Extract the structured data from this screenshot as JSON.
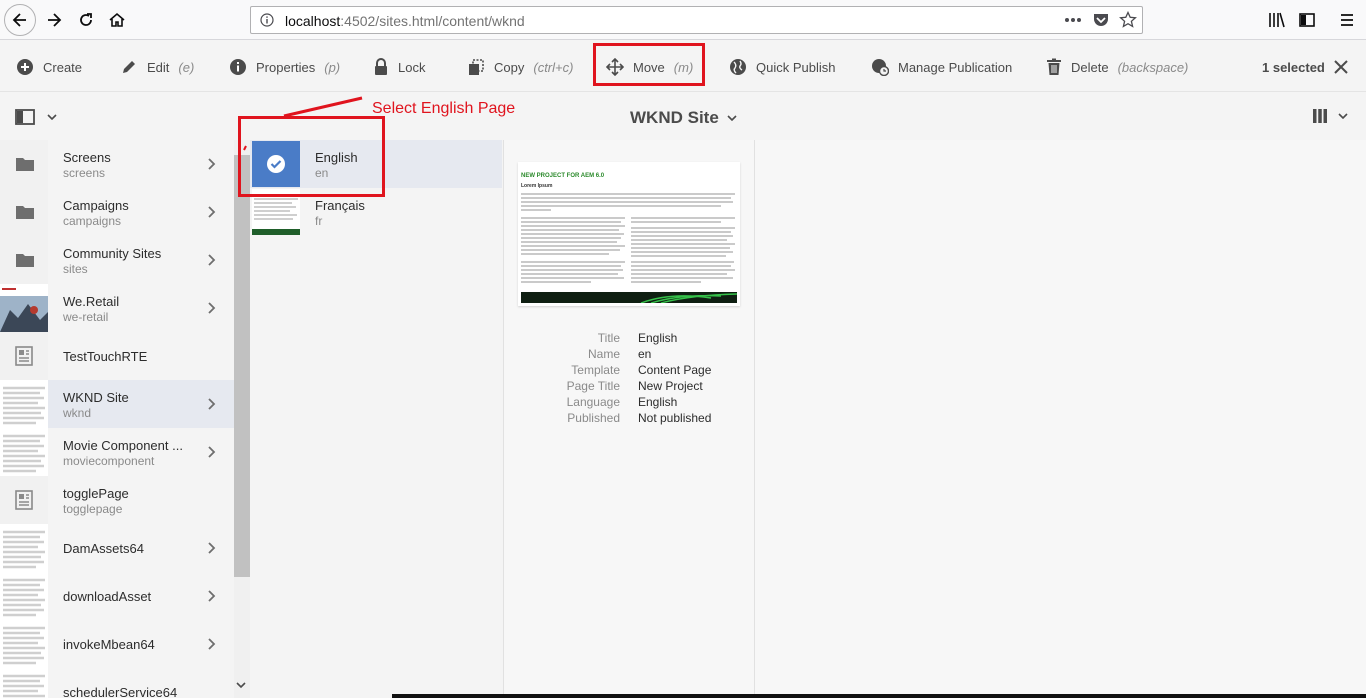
{
  "browser": {
    "url_host": "localhost",
    "url_rest": ":4502/sites.html/content/wknd"
  },
  "actions": {
    "create": "Create",
    "edit": "Edit",
    "edit_sc": "(e)",
    "properties": "Properties",
    "properties_sc": "(p)",
    "lock": "Lock",
    "copy": "Copy",
    "copy_sc": "(ctrl+c)",
    "move": "Move",
    "move_sc": "(m)",
    "quick_publish": "Quick Publish",
    "manage_publication": "Manage Publication",
    "delete": "Delete",
    "delete_sc": "(backspace)",
    "selected": "1 selected"
  },
  "header": {
    "site_title": "WKND Site"
  },
  "annotation": {
    "text": "Select English Page",
    "color": "#e0141e"
  },
  "column1": [
    {
      "name": "Screens",
      "sub": "screens",
      "thumb": "folder"
    },
    {
      "name": "Campaigns",
      "sub": "campaigns",
      "thumb": "folder"
    },
    {
      "name": "Community Sites",
      "sub": "sites",
      "thumb": "folder"
    },
    {
      "name": "We.Retail",
      "sub": "we-retail",
      "thumb": "photo"
    },
    {
      "name": "TestTouchRTE",
      "sub": "",
      "thumb": "page"
    },
    {
      "name": "WKND Site",
      "sub": "wknd",
      "thumb": "doc"
    },
    {
      "name": "Movie Component ...",
      "sub": "moviecomponent",
      "thumb": "doc"
    },
    {
      "name": "togglePage",
      "sub": "togglepage",
      "thumb": "page"
    },
    {
      "name": "DamAssets64",
      "sub": "",
      "thumb": "doc"
    },
    {
      "name": "downloadAsset",
      "sub": "",
      "thumb": "doc"
    },
    {
      "name": "invokeMbean64",
      "sub": "",
      "thumb": "doc"
    },
    {
      "name": "schedulerService64",
      "sub": "",
      "thumb": "doc"
    }
  ],
  "column2": [
    {
      "name": "English",
      "sub": "en"
    },
    {
      "name": "Français",
      "sub": "fr"
    }
  ],
  "preview": {
    "heading": "NEW PROJECT FOR AEM 6.0",
    "subheading": "Lorem Ipsum"
  },
  "meta": [
    {
      "key": "Title",
      "value": "English"
    },
    {
      "key": "Name",
      "value": "en"
    },
    {
      "key": "Template",
      "value": "Content Page"
    },
    {
      "key": "Page Title",
      "value": "New Project"
    },
    {
      "key": "Language",
      "value": "English"
    },
    {
      "key": "Published",
      "value": "Not published"
    }
  ]
}
